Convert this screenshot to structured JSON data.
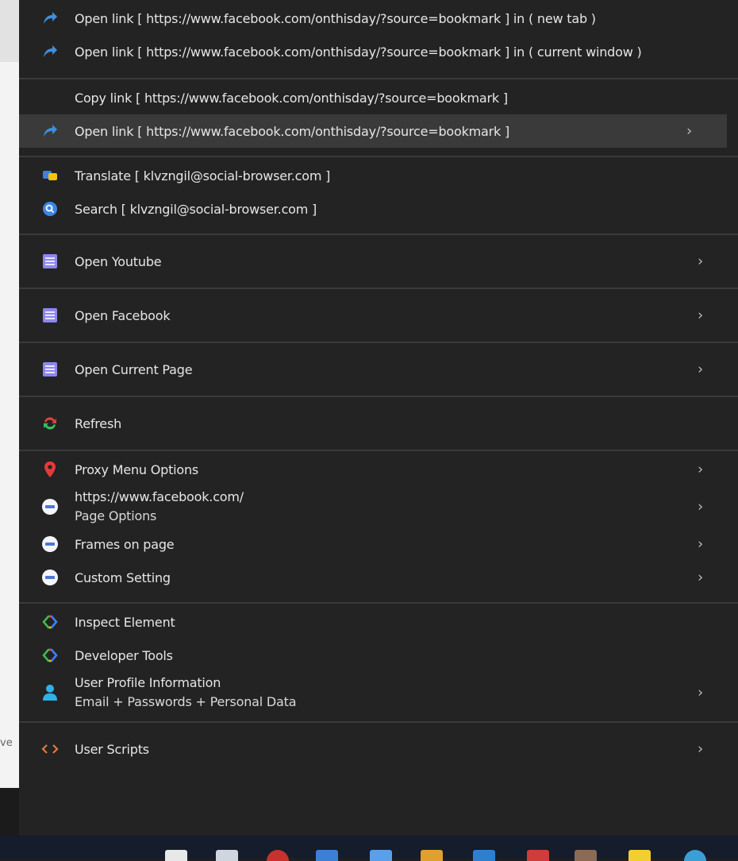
{
  "background": {
    "edge_text": "ve",
    "color": "#f3f3f3"
  },
  "menu": {
    "groups": [
      [
        {
          "label": "Open link  [ https://www.facebook.com/onthisday/?source=bookmark ]  in ( new tab )",
          "icon": "share-arrow-icon"
        },
        {
          "label": "Open link  [ https://www.facebook.com/onthisday/?source=bookmark ]  in ( current window )",
          "icon": "share-arrow-icon"
        }
      ],
      [
        {
          "label": "Copy link  [ https://www.facebook.com/onthisday/?source=bookmark ]",
          "icon": ""
        },
        {
          "label": "Open link  [ https://www.facebook.com/onthisday/?source=bookmark ]",
          "icon": "share-arrow-icon",
          "submenu": true,
          "highlighted": true
        }
      ],
      [
        {
          "label": "Translate [ klvzngil@social-browser.com ]",
          "icon": "translate-icon"
        },
        {
          "label": "Search  [ klvzngil@social-browser.com ]",
          "icon": "search-icon"
        }
      ],
      [
        {
          "label": "Open Youtube",
          "icon": "window-icon",
          "submenu": true
        }
      ],
      [
        {
          "label": "Open Facebook",
          "icon": "window-icon",
          "submenu": true
        }
      ],
      [
        {
          "label": "Open Current Page",
          "icon": "window-icon",
          "submenu": true
        }
      ],
      [
        {
          "label": "Refresh",
          "icon": "refresh-icon"
        }
      ],
      [
        {
          "label": "Proxy Menu Options",
          "icon": "location-pin-icon",
          "submenu": true
        },
        {
          "label": "https://www.facebook.com/",
          "sublabel": "Page Options",
          "icon": "globe-icon",
          "submenu": true
        },
        {
          "label": "Frames on page",
          "icon": "globe-icon",
          "submenu": true
        },
        {
          "label": "Custom Setting",
          "icon": "globe-icon",
          "submenu": true
        }
      ],
      [
        {
          "label": "Inspect Element",
          "icon": "devtools-icon"
        },
        {
          "label": "Developer Tools",
          "icon": "devtools-icon"
        },
        {
          "label": "User Profile Information",
          "sublabel": "Email + Passwords + Personal Data",
          "icon": "user-icon",
          "submenu": true
        }
      ],
      [
        {
          "label": "User Scripts",
          "icon": "code-icon",
          "submenu": true
        }
      ]
    ],
    "chevron": "›"
  },
  "colors": {
    "menu_bg": "#232323",
    "highlight": "#3a3a3a",
    "separator": "#3a3a3a",
    "text": "#e6e6e6",
    "taskbar": "#151c2c"
  }
}
